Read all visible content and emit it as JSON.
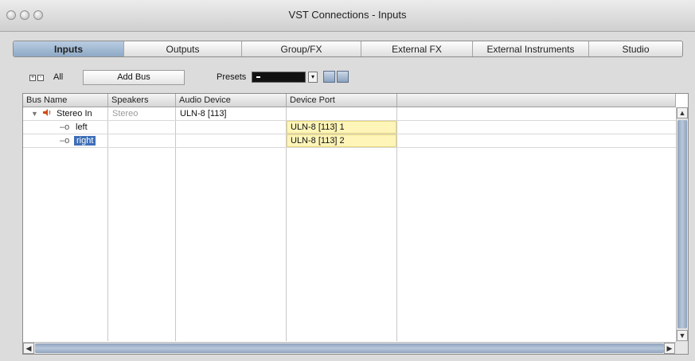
{
  "window": {
    "title": "VST Connections - Inputs"
  },
  "tabs": [
    {
      "label": "Inputs",
      "active": true
    },
    {
      "label": "Outputs",
      "active": false
    },
    {
      "label": "Group/FX",
      "active": false
    },
    {
      "label": "External FX",
      "active": false
    },
    {
      "label": "External Instruments",
      "active": false
    },
    {
      "label": "Studio",
      "active": false
    }
  ],
  "toolbar": {
    "all_label": "All",
    "add_bus_label": "Add Bus",
    "presets_label": "Presets",
    "presets_value": "-"
  },
  "table": {
    "columns": [
      "Bus Name",
      "Speakers",
      "Audio Device",
      "Device Port"
    ],
    "rows": [
      {
        "bus_name": "Stereo In",
        "speakers": "Stereo",
        "audio_device": "ULN-8 [113]",
        "device_port": ""
      },
      {
        "bus_name": "left",
        "speakers": "",
        "audio_device": "",
        "device_port": "ULN-8 [113] 1"
      },
      {
        "bus_name": "right",
        "speakers": "",
        "audio_device": "",
        "device_port": "ULN-8 [113] 2"
      }
    ]
  },
  "colors": {
    "port_highlight": "#fff5b8",
    "selection": "#3e6fb8",
    "active_tab": "#a5bcd6"
  },
  "icons": {
    "speaker": "speaker-icon",
    "disclosure": "triangle-down-icon",
    "channel": "connector-icon"
  }
}
